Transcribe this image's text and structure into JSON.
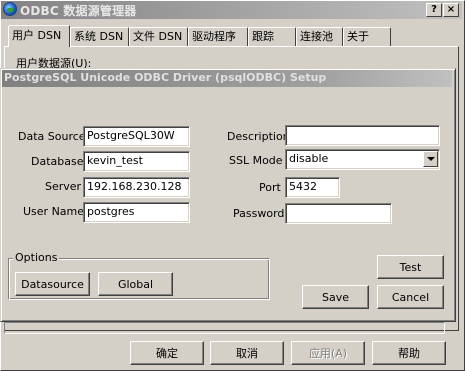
{
  "outer_window": {
    "title": "ODBC 数据源管理器",
    "help_button": "?",
    "close_button": "×",
    "tabs": [
      {
        "label": "用户 DSN",
        "active": true
      },
      {
        "label": "系统 DSN",
        "active": false
      },
      {
        "label": "文件 DSN",
        "active": false
      },
      {
        "label": "驱动程序",
        "active": false
      },
      {
        "label": "跟踪",
        "active": false
      },
      {
        "label": "连接池",
        "active": false
      },
      {
        "label": "关于",
        "active": false
      }
    ],
    "panel_label": "用户数据源(U):",
    "buttons": {
      "ok": "确定",
      "cancel": "取消",
      "apply": "应用(A)",
      "help": "帮助"
    }
  },
  "dialog": {
    "title": "PostgreSQL Unicode ODBC Driver (psqlODBC) Setup",
    "fields": {
      "data_source": {
        "label": "Data Source",
        "value": "PostgreSQL30W"
      },
      "database": {
        "label": "Database",
        "value": "kevin_test"
      },
      "server": {
        "label": "Server",
        "value": "192.168.230.128"
      },
      "user_name": {
        "label": "User Name",
        "value": "postgres"
      },
      "description": {
        "label": "Description",
        "value": ""
      },
      "ssl_mode": {
        "label": "SSL Mode",
        "value": "disable"
      },
      "port": {
        "label": "Port",
        "value": "5432"
      },
      "password": {
        "label": "Password",
        "value": ""
      }
    },
    "options": {
      "legend": "Options",
      "datasource_button": "Datasource",
      "global_button": "Global"
    },
    "buttons": {
      "test": "Test",
      "save": "Save",
      "cancel": "Cancel"
    }
  }
}
